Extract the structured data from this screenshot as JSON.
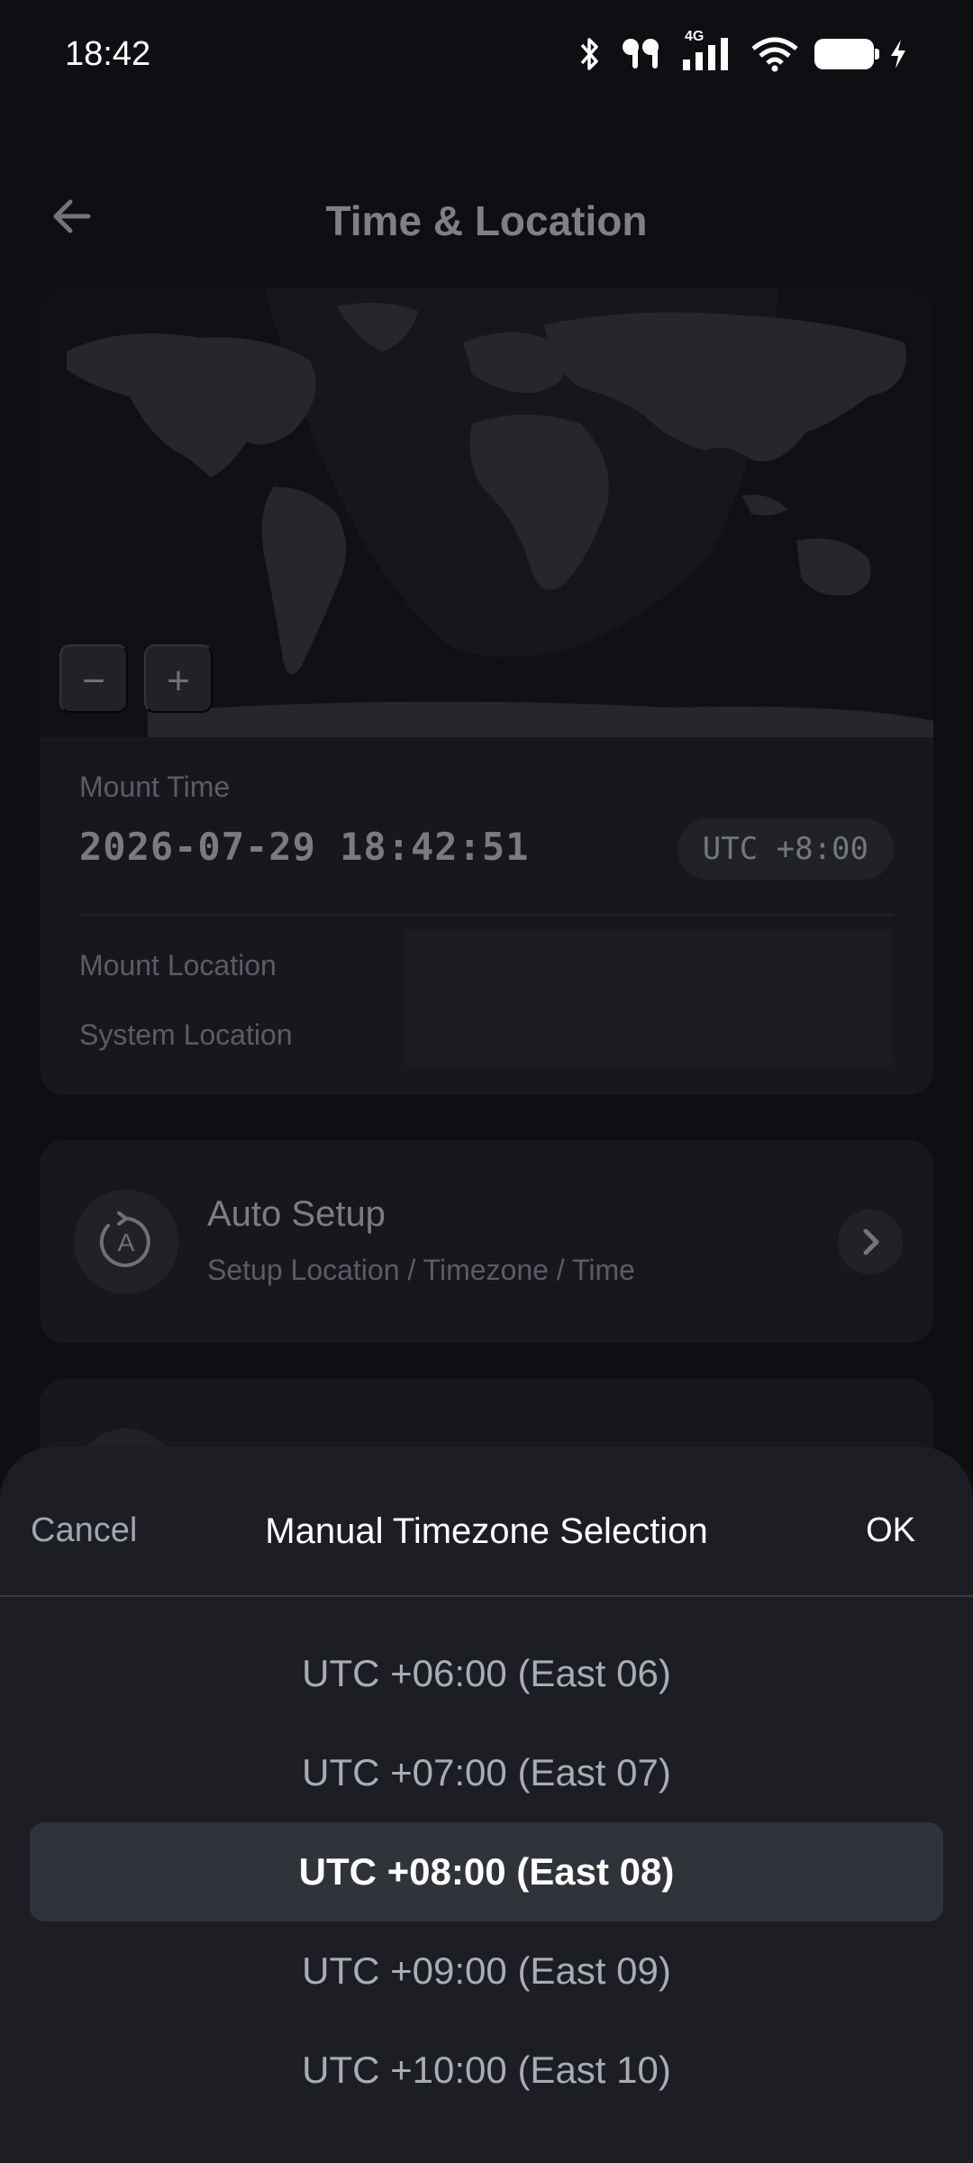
{
  "status_bar": {
    "time": "18:42",
    "network": "4G",
    "icons": [
      "bluetooth-icon",
      "earbuds-icon",
      "signal-icon",
      "wifi-icon",
      "battery-icon",
      "charging-icon"
    ]
  },
  "header": {
    "title": "Time & Location",
    "back_icon": "arrow-left-icon"
  },
  "map": {
    "zoom_out_label": "−",
    "zoom_in_label": "+"
  },
  "mount_time": {
    "label": "Mount Time",
    "value": "2026-07-29 18:42:51",
    "timezone": "UTC +8:00"
  },
  "location": {
    "mount_label": "Mount Location",
    "system_label": "System Location"
  },
  "auto_setup": {
    "title": "Auto Setup",
    "subtitle": "Setup Location / Timezone / Time"
  },
  "sheet": {
    "cancel_label": "Cancel",
    "title": "Manual Timezone Selection",
    "ok_label": "OK",
    "options": [
      "UTC +06:00 (East 06)",
      "UTC +07:00 (East 07)",
      "UTC +08:00 (East 08)",
      "UTC +09:00 (East 09)",
      "UTC +10:00 (East 10)"
    ],
    "selected_index": 2
  },
  "colors": {
    "background": "#0e0f12",
    "card": "#1f2128",
    "sheet": "#1c1e24",
    "selected_row": "#31333a"
  }
}
